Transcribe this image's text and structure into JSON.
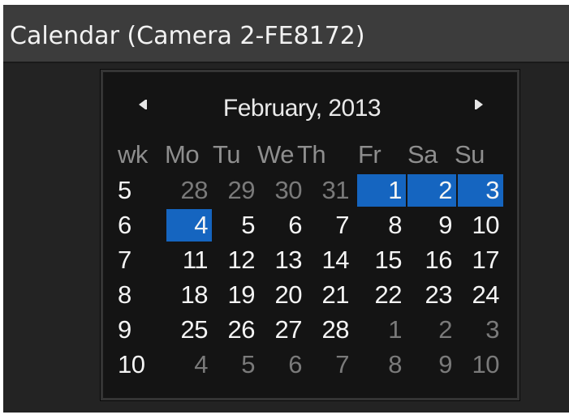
{
  "window": {
    "title": "Calendar (Camera 2-FE8172)"
  },
  "calendar": {
    "month_label": "February, 2013",
    "prev_icon": "triangle-left",
    "next_icon": "triangle-right",
    "selected_color": "#1565c0",
    "headers": [
      "wk",
      "Mo",
      "Tu",
      "We",
      "Th",
      "Fr",
      "Sa",
      "Su"
    ],
    "weeks": [
      {
        "wk": "5",
        "days": [
          {
            "d": "28",
            "other": true
          },
          {
            "d": "29",
            "other": true
          },
          {
            "d": "30",
            "other": true
          },
          {
            "d": "31",
            "other": true
          },
          {
            "d": "1",
            "selected": true
          },
          {
            "d": "2",
            "selected": true
          },
          {
            "d": "3",
            "selected": true
          }
        ]
      },
      {
        "wk": "6",
        "days": [
          {
            "d": "4",
            "selected": true
          },
          {
            "d": "5"
          },
          {
            "d": "6"
          },
          {
            "d": "7"
          },
          {
            "d": "8"
          },
          {
            "d": "9"
          },
          {
            "d": "10"
          }
        ]
      },
      {
        "wk": "7",
        "days": [
          {
            "d": "11"
          },
          {
            "d": "12"
          },
          {
            "d": "13"
          },
          {
            "d": "14"
          },
          {
            "d": "15"
          },
          {
            "d": "16"
          },
          {
            "d": "17"
          }
        ]
      },
      {
        "wk": "8",
        "days": [
          {
            "d": "18"
          },
          {
            "d": "19"
          },
          {
            "d": "20"
          },
          {
            "d": "21"
          },
          {
            "d": "22"
          },
          {
            "d": "23"
          },
          {
            "d": "24"
          }
        ]
      },
      {
        "wk": "9",
        "days": [
          {
            "d": "25"
          },
          {
            "d": "26"
          },
          {
            "d": "27"
          },
          {
            "d": "28"
          },
          {
            "d": "1",
            "other": true
          },
          {
            "d": "2",
            "other": true
          },
          {
            "d": "3",
            "other": true
          }
        ]
      },
      {
        "wk": "10",
        "days": [
          {
            "d": "4",
            "other": true
          },
          {
            "d": "5",
            "other": true
          },
          {
            "d": "6",
            "other": true
          },
          {
            "d": "7",
            "other": true
          },
          {
            "d": "8",
            "other": true
          },
          {
            "d": "9",
            "other": true
          },
          {
            "d": "10",
            "other": true
          }
        ]
      }
    ]
  }
}
